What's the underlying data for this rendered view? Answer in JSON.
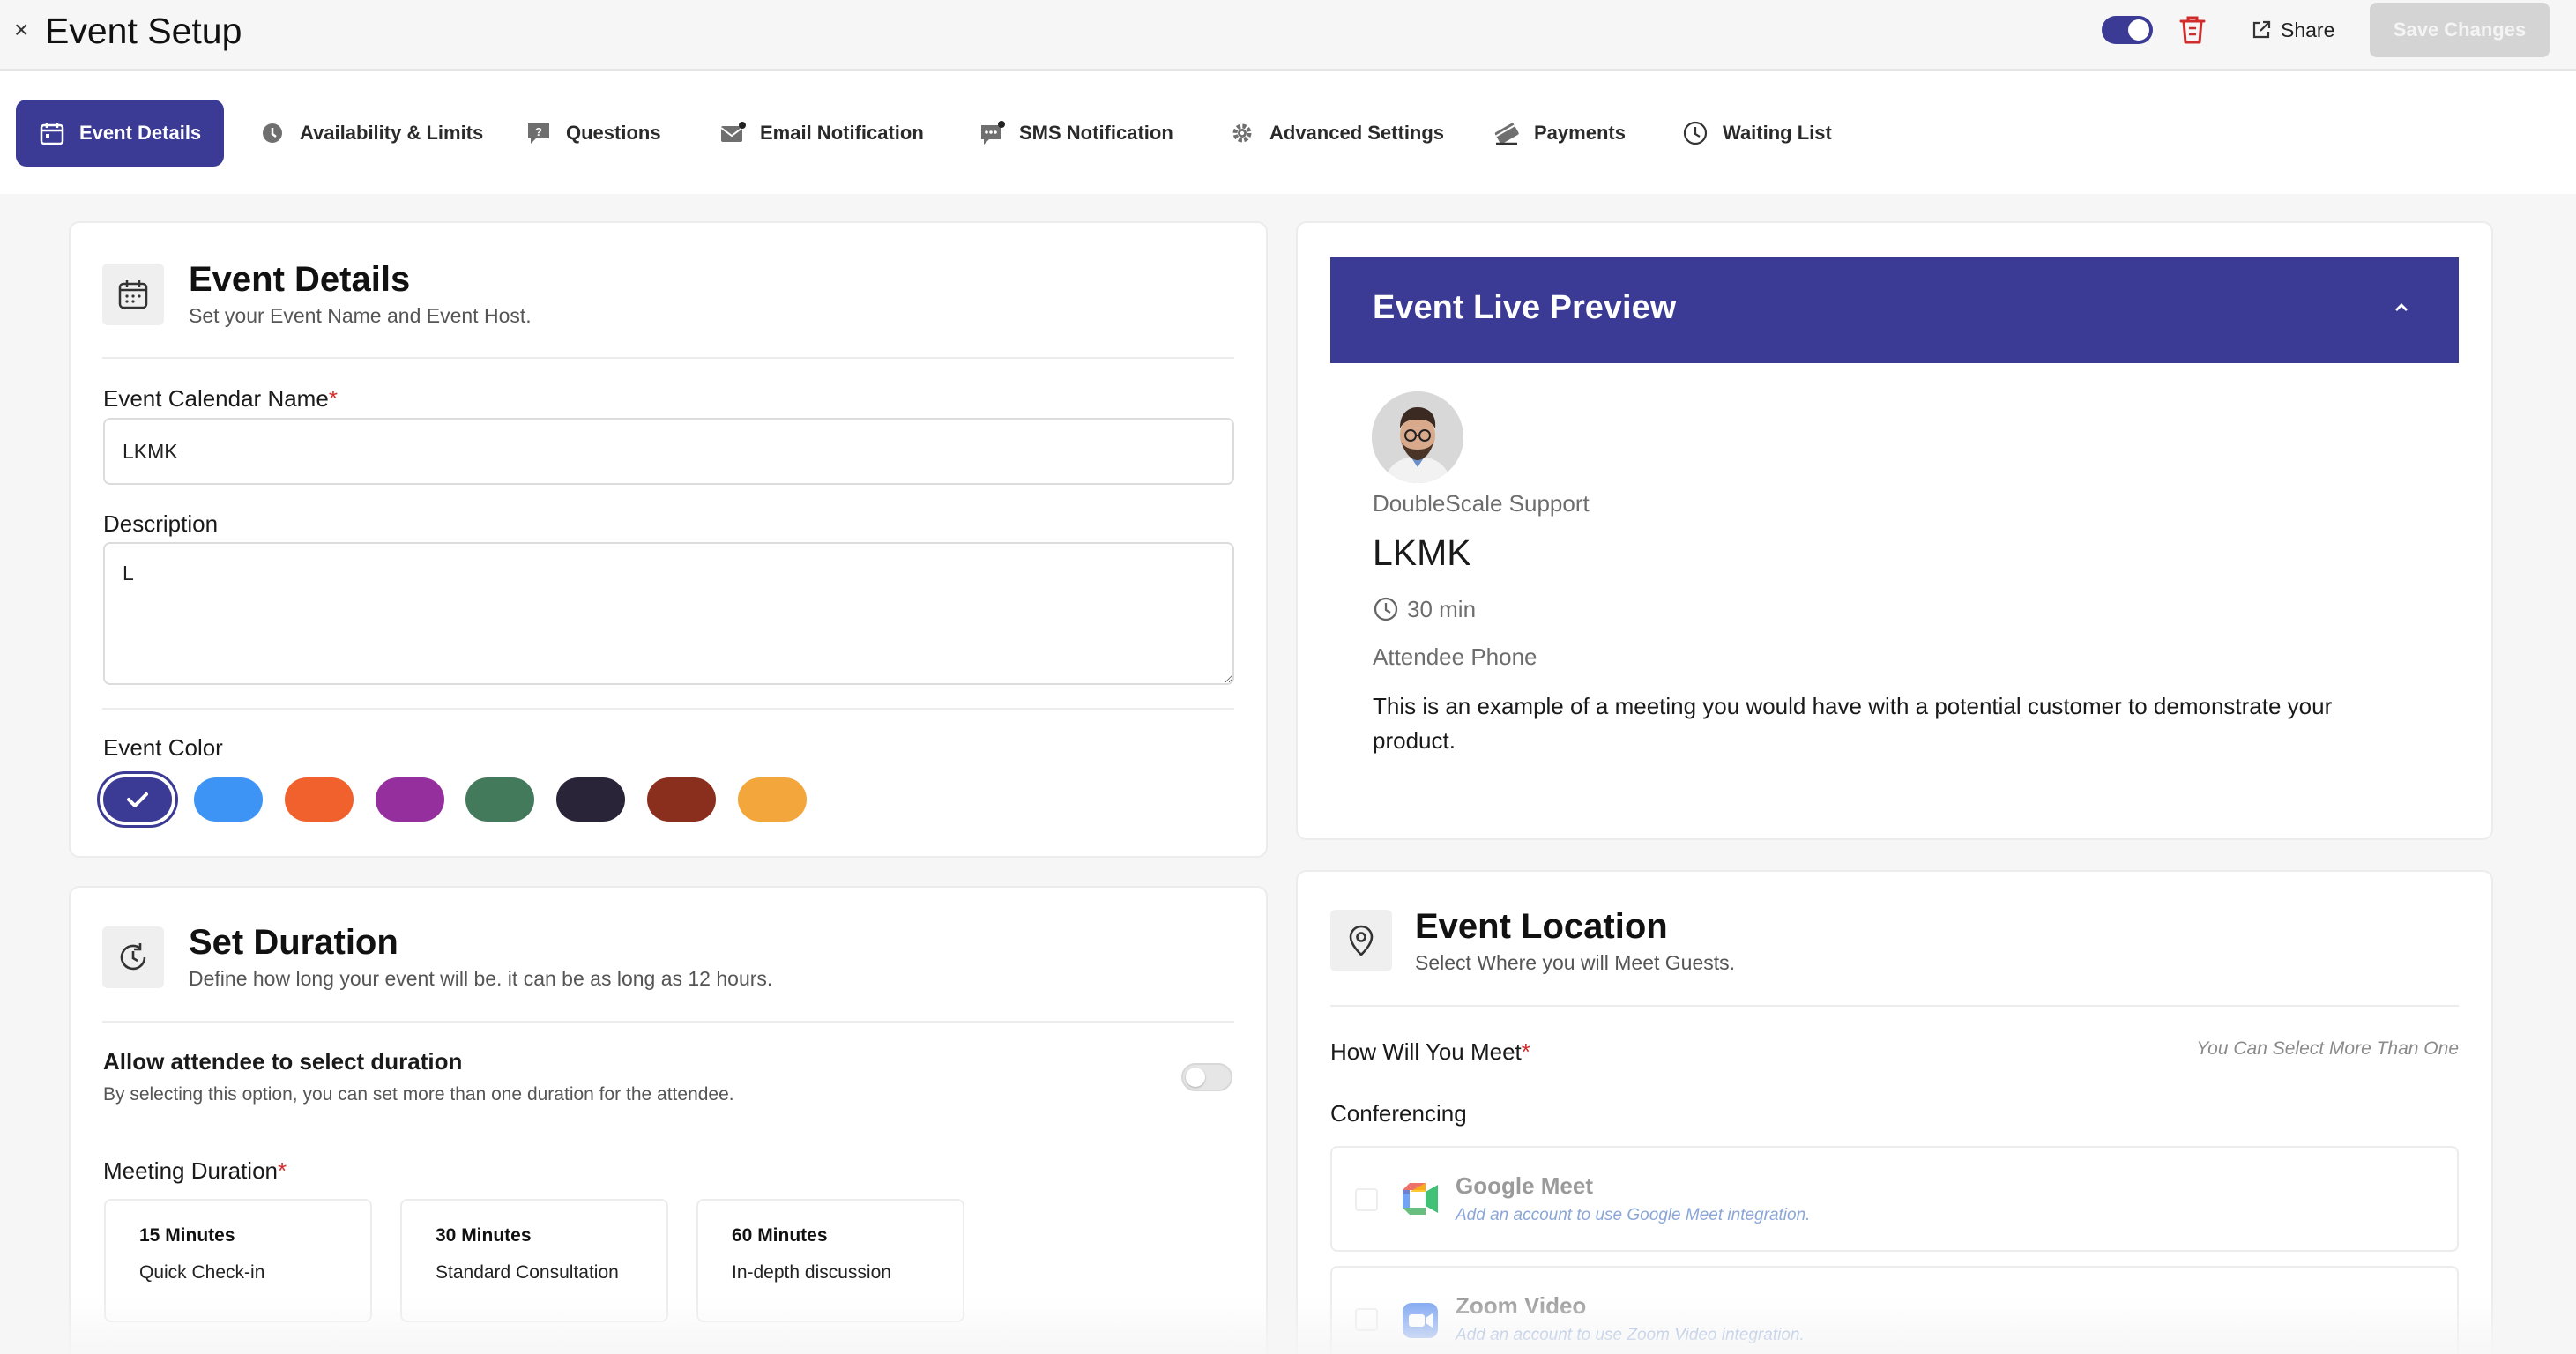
{
  "header": {
    "close_glyph": "×",
    "title": "Event Setup",
    "share_label": "Share",
    "save_label": "Save Changes"
  },
  "tabs": [
    {
      "label": "Event Details",
      "icon": "calendar-icon",
      "active": true
    },
    {
      "label": "Availability & Limits",
      "icon": "clock-icon",
      "active": false
    },
    {
      "label": "Questions",
      "icon": "question-icon",
      "active": false
    },
    {
      "label": "Email Notification",
      "icon": "mail-icon",
      "active": false
    },
    {
      "label": "SMS Notification",
      "icon": "chat-icon",
      "active": false
    },
    {
      "label": "Advanced Settings",
      "icon": "gear-icon",
      "active": false
    },
    {
      "label": "Payments",
      "icon": "card-icon",
      "active": false
    },
    {
      "label": "Waiting List",
      "icon": "clock-icon",
      "active": false
    }
  ],
  "event_details": {
    "title": "Event Details",
    "subtitle": "Set your Event Name and Event Host.",
    "calendar_name_label": "Event Calendar Name",
    "required_mark": "*",
    "calendar_name_value": "LKMK",
    "description_label": "Description",
    "description_value": "L",
    "color_label": "Event Color",
    "colors": [
      "#3b3a95",
      "#3e94f5",
      "#f0612d",
      "#952f9e",
      "#447a5c",
      "#2a2439",
      "#8a2f1e",
      "#f2a63c"
    ],
    "selected_color_index": 0
  },
  "duration": {
    "title": "Set Duration",
    "subtitle": "Define how long your event will be. it can be as long as 12 hours.",
    "allow_label": "Allow attendee to select duration",
    "allow_help": "By selecting this option, you can set more than one duration for the attendee.",
    "allow_enabled": false,
    "meeting_label": "Meeting Duration",
    "options": [
      {
        "title": "15 Minutes",
        "sub": "Quick Check-in"
      },
      {
        "title": "30 Minutes",
        "sub": "Standard Consultation"
      },
      {
        "title": "60 Minutes",
        "sub": "In-depth discussion"
      }
    ]
  },
  "preview": {
    "title": "Event Live Preview",
    "host": "DoubleScale Support",
    "event_name": "LKMK",
    "duration": "30 min",
    "location": "Attendee Phone",
    "description": "This is an example of a meeting you would have with a potential customer to demonstrate your product."
  },
  "location": {
    "title": "Event Location",
    "subtitle": "Select Where you will Meet Guests.",
    "how_label": "How Will You Meet",
    "hint": "You Can Select More Than One",
    "conferencing_label": "Conferencing",
    "options": [
      {
        "name": "Google Meet",
        "sub": "Add an account to use Google Meet integration."
      },
      {
        "name": "Zoom Video",
        "sub": "Add an account to use Zoom Video integration."
      }
    ]
  },
  "colors": {
    "accent": "#3b3a95",
    "required": "#d12c2c"
  }
}
